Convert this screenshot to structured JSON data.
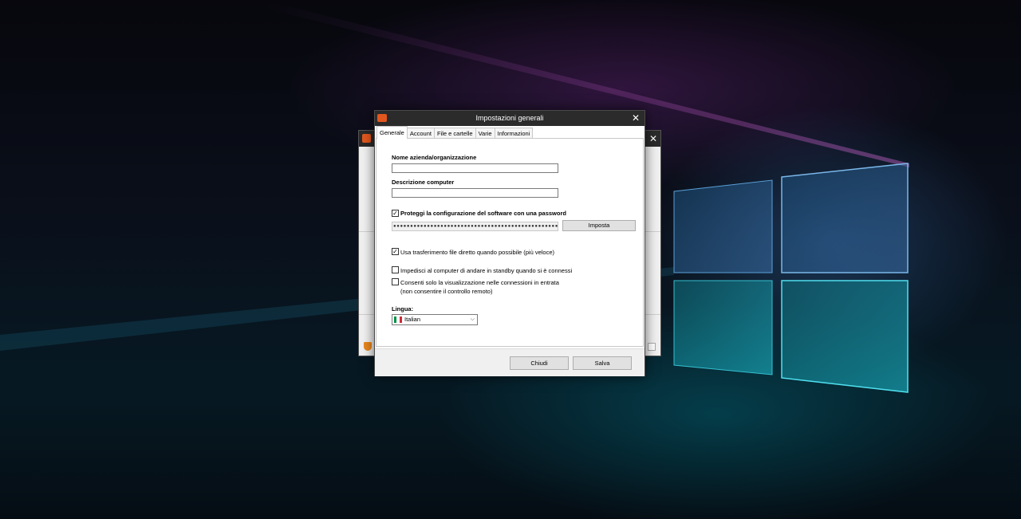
{
  "dialog": {
    "title": "Impostazioni generali",
    "close_glyph": "✕"
  },
  "background_window": {
    "close_glyph": "✕"
  },
  "tabs": [
    {
      "label": "Generale",
      "active": true
    },
    {
      "label": "Account",
      "active": false
    },
    {
      "label": "File e cartelle",
      "active": false
    },
    {
      "label": "Varie",
      "active": false
    },
    {
      "label": "Informazioni",
      "active": false
    }
  ],
  "general": {
    "company_label": "Nome azienda/organizzazione",
    "company_value": "",
    "computer_desc_label": "Descrizione computer",
    "computer_desc_value": "",
    "protect_label": "Proteggi la configurazione del software con una password",
    "protect_checked": true,
    "password_mask": "●●●●●●●●●●●●●●●●●●●●●●●●●●●●●●●●●●●●●●●●●●●●●●●●●●●●●",
    "set_button": "Imposta",
    "direct_transfer_label": "Usa trasferimento file diretto quando possibile (più veloce)",
    "direct_transfer_checked": true,
    "prevent_standby_label": "Impedisci al computer di andare in standby quando si è connessi",
    "prevent_standby_checked": false,
    "view_only_label_line1": "Consenti solo la visualizzazione nelle connessioni in entrata",
    "view_only_label_line2": "(non consentire il controllo remoto)",
    "view_only_checked": false,
    "language_label": "Lingua:",
    "language_value": "Italian"
  },
  "footer": {
    "close_button": "Chiudi",
    "save_button": "Salva"
  },
  "icons": {
    "check_glyph": "✓",
    "dropdown_glyph": "⌵"
  },
  "colors": {
    "titlebar": "#2b2b2b",
    "app_logo": "#e2571e"
  }
}
